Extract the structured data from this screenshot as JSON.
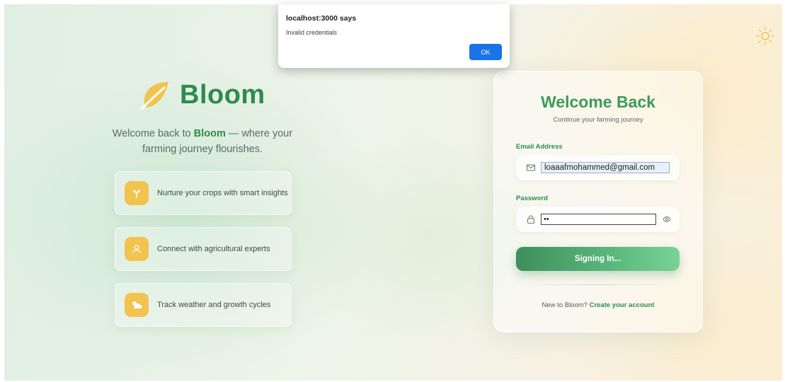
{
  "alert": {
    "title": "localhost:3000 says",
    "message": "Invalid credentials",
    "ok_label": "OK"
  },
  "brand": {
    "name": "Bloom",
    "tagline_prefix": "Welcome back to ",
    "tagline_brand": "Bloom",
    "tagline_suffix": " — where your farming journey flourishes.",
    "logo_color": "#f2c34f",
    "accent_color": "#2f8a4e"
  },
  "features": [
    {
      "icon": "sprout-icon",
      "text": "Nurture your crops with smart insights"
    },
    {
      "icon": "user-icon",
      "text": "Connect with agricultural experts"
    },
    {
      "icon": "weather-icon",
      "text": "Track weather and growth cycles"
    }
  ],
  "login": {
    "title": "Welcome Back",
    "subtitle": "Continue your farming journey",
    "email_label": "Email Address",
    "email_value": "loaaafmohammed@gmail.com",
    "password_label": "Password",
    "password_value": "••",
    "submit_label": "Signing In...",
    "signup_prompt": "New to Bloom?",
    "signup_link": "Create your account"
  },
  "theme_toggle": {
    "icon": "sun-icon"
  }
}
